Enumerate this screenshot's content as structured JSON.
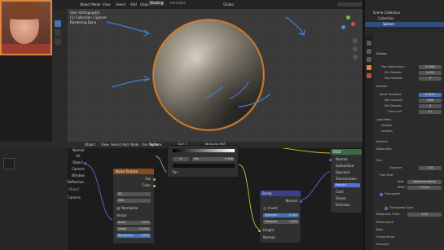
{
  "topbar": {
    "menus": [
      "View",
      "Select",
      "Add",
      "Object"
    ],
    "mode": "Object Mode",
    "workspace_tabs": [
      "Layout",
      "Modeling",
      "Sculpting",
      "UV Editing",
      "Texture Paint",
      "Shading",
      "Animation"
    ],
    "active_tab": "Shading",
    "transform": "Global"
  },
  "viewport": {
    "info_line1": "User Orthographic",
    "info_line2": "(1) Collection | Sphere",
    "info_line3": "Rendering Done"
  },
  "outliner": {
    "title": "Scene Collection",
    "collection": "Collection",
    "object": "Sphere"
  },
  "node_header": {
    "menus": [
      "Object",
      "View",
      "Select",
      "Add",
      "Node"
    ],
    "use_nodes": "Use Nodes",
    "material": "Material.001",
    "object_name": "Sphere",
    "slot": "Slot 1",
    "material_top": "Material.001"
  },
  "nodes": {
    "texcoord": {
      "title": "Texture Coordinate",
      "outputs": [
        "Normal",
        "UV",
        "Object",
        "Camera",
        "Window",
        "Reflection"
      ],
      "object_label": "Object",
      "camera_label": "Camera"
    },
    "noise": {
      "title": "Noise Texture",
      "out_fac": "Fac",
      "out_color": "Color",
      "dim": "3D",
      "type": "fBM",
      "normalize": "Normalize",
      "vector": "Vector",
      "scale_label": "Scale",
      "scale_value": "1.000",
      "detail_label": "Detail",
      "detail_value": "12.000",
      "rough_label": "Roughness",
      "rough_value": "0.650"
    },
    "colorramp": {
      "stop_index": "0",
      "pos_label": "Pos",
      "pos_value": "0.486",
      "fac": "Fac"
    },
    "bump": {
      "title": "Bump",
      "out_normal": "Normal",
      "invert": "Invert",
      "strength_label": "Strength",
      "strength_value": "0.283",
      "distance_label": "Distance",
      "distance_value": "1.000",
      "height": "Height",
      "normal_in": "Normal"
    },
    "bsdf": {
      "title": "BSDF",
      "rows": [
        "Normal",
        "Subsurface",
        "Specular",
        "Transmission",
        "Coat",
        "Sheen",
        "Emission"
      ],
      "highlight": "Weight"
    }
  },
  "properties": {
    "sections": [
      "Preview",
      "Surface",
      "Volume",
      "Settings",
      "Line Art",
      "Viewport Display",
      "Custom Properties"
    ],
    "surface_label": "Surface",
    "method_label": "Max Subdivisions",
    "method_value": "0.1000",
    "min_samples_label": "Min Samples",
    "min_samples_value": "0.016",
    "max_samples_label": "Max Samples",
    "max_samples_value": "0",
    "rows": [
      {
        "label": "Noise Threshold",
        "value": "0.1000"
      },
      {
        "label": "Max Samples",
        "value": "1024"
      },
      {
        "label": "Min Samples",
        "value": "0"
      },
      {
        "label": "Denoise",
        "value": ""
      },
      {
        "label": "Noise Threshold",
        "value": "0.0100"
      },
      {
        "label": "Max Samples",
        "value": "4096"
      },
      {
        "label": "Min Samples",
        "value": "0"
      },
      {
        "label": "Time Limit",
        "value": "0 s"
      }
    ],
    "light_paths": "Light Paths",
    "bounces": "Denoise",
    "caustics": "Caustics",
    "volumes": "Volumes",
    "motion_blur": "Motion Blur",
    "film": "Film",
    "exposure_label": "Exposure",
    "exposure_value": "1.00",
    "pixel_filter": "Pixel Filter",
    "filter_type_label": "Type",
    "filter_type_value": "Blackman-Harris",
    "width_label": "Width",
    "width_value": "1.50 px",
    "transparent": "Transparent",
    "transparent_glass": "Transparent Glass",
    "roughness_thr_label": "Roughness Thres.",
    "roughness_thr_value": "0.10",
    "performance": "Performance",
    "bake": "Bake",
    "grease_pencil": "Grease Pencil",
    "freestyle": "Freestyle"
  },
  "colors": {
    "accent": "#e08a2d",
    "noise_header": "#8a4a20",
    "bump_header": "#3b3f8c",
    "bsdf_highlight": "#5470d8",
    "panel_bg": "#2b2b2b",
    "viewport_bg": "#3a3a3a"
  }
}
